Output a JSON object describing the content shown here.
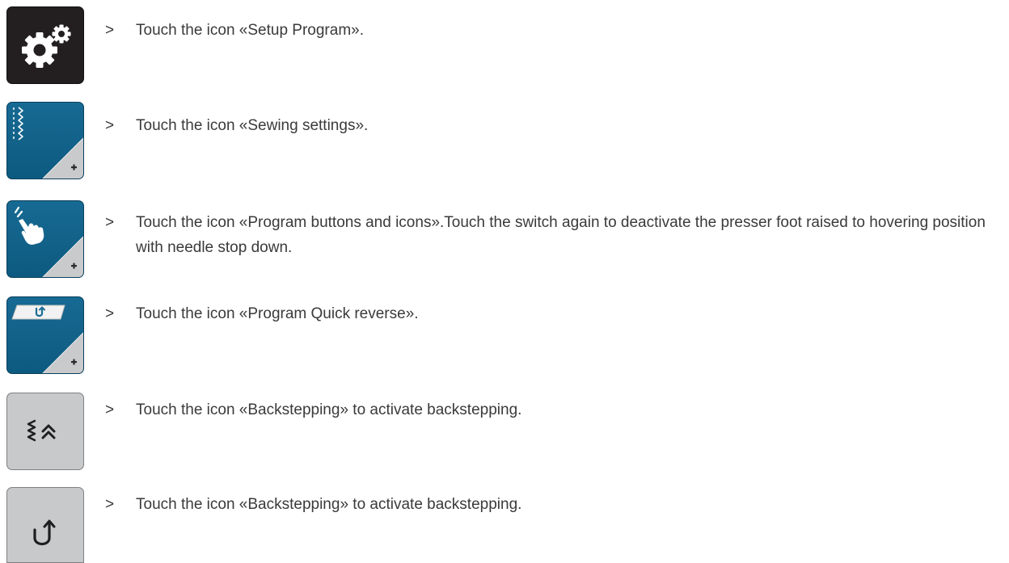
{
  "steps": [
    {
      "icon": "setup-program-icon",
      "marker": ">",
      "text": "Touch the icon «Setup Program»."
    },
    {
      "icon": "sewing-settings-icon",
      "marker": ">",
      "text": "Touch the icon «Sewing settings»."
    },
    {
      "icon": "program-buttons-icons-icon",
      "marker": ">",
      "text": "Touch the icon «Program buttons and icons».Touch the switch again to deactivate the presser foot raised to hovering position with needle stop down."
    },
    {
      "icon": "program-quick-reverse-icon",
      "marker": ">",
      "text": "Touch the icon «Program Quick reverse»."
    },
    {
      "icon": "backstepping-icon",
      "marker": ">",
      "text": "Touch the icon «Backstepping» to activate backstepping."
    },
    {
      "icon": "reverse-hook-icon",
      "marker": ">",
      "text": "Touch the icon «Backstepping» to activate backstepping."
    }
  ],
  "colors": {
    "dark_icon": "#231f20",
    "blue_icon": "#0e5f87",
    "gray_icon": "#c8c9cb",
    "text": "#3a3a3a"
  }
}
